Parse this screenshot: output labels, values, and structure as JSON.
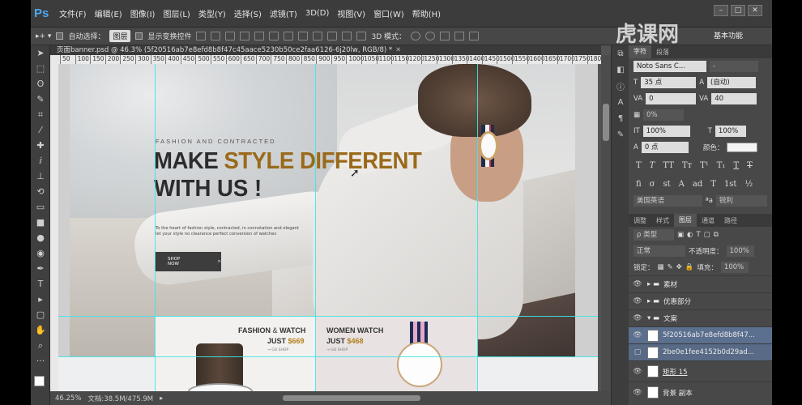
{
  "app": {
    "logo": "Ps"
  },
  "menu": [
    "文件(F)",
    "编辑(E)",
    "图像(I)",
    "图层(L)",
    "类型(Y)",
    "选择(S)",
    "滤镜(T)",
    "3D(D)",
    "视图(V)",
    "窗口(W)",
    "帮助(H)"
  ],
  "options": {
    "auto_select_label": "自动选择：",
    "auto_select_value": "图层",
    "show_transform": "显示变换控件",
    "mode_3d": "3D 模式：",
    "workspace": "基本功能"
  },
  "document": {
    "tab_title": "页面banner.psd @ 46.3% (5f20516ab7e8efd8b8f47c45aace5230b50ce2faa6126-6j20lw, RGB/8) *",
    "ruler_ticks": [
      "50",
      "100",
      "150",
      "200",
      "250",
      "300",
      "350",
      "400",
      "450",
      "500",
      "550",
      "600",
      "650",
      "700",
      "750",
      "800",
      "850",
      "900",
      "950",
      "1000",
      "1050",
      "1100",
      "1150",
      "1200",
      "1250",
      "1300",
      "1350",
      "1400",
      "1450",
      "1500",
      "1550",
      "1600",
      "1650",
      "1700",
      "1750",
      "1800"
    ]
  },
  "canvas": {
    "sub": "FASHION AND CONTRACTED",
    "head_a": "MAKE ",
    "head_b": "STYLE DIFFERENT",
    "head_c": "WITH US !",
    "para1": "To the heart of fashion style, contracted, in connotation and elegant",
    "para2": "let your style no clearance perfect conversion of watches",
    "shop": "SHOP NOW",
    "shop_arrow": ">",
    "p1_title_a": "FASHION",
    "p1_amp": "&",
    "p1_title_b": "WATCH",
    "p1_just": "JUST ",
    "p1_price": "$669",
    "p1_link": "→ GO SHOP",
    "p2_title": "WOMEN WATCH",
    "p2_just": "JUST ",
    "p2_price": "$468",
    "p2_link": "→ GO SHOP"
  },
  "status": {
    "zoom": "46.25%",
    "doc": "文档:38.5M/475.9M"
  },
  "char_panel": {
    "tabs": [
      "字符",
      "段落"
    ],
    "font": "Noto Sans C...",
    "style": "-",
    "size": "35 点",
    "leading": "(自动)",
    "kerning": "0",
    "tracking": "40",
    "vscale_percent": "0%",
    "vert_scale": "100%",
    "horiz_scale": "100%",
    "baseline": "0 点",
    "color_label": "颜色：",
    "lang": "美国英语",
    "aa_label": "ªa",
    "aa": "锐利"
  },
  "layers_panel": {
    "tabs": [
      "调整",
      "样式",
      "图层",
      "通道",
      "路径"
    ],
    "kind": "ρ 类型",
    "blend": "正常",
    "opacity_label": "不透明度：",
    "opacity": "100%",
    "lock_label": "锁定：",
    "fill_label": "填充：",
    "fill": "100%",
    "layers": [
      {
        "name": "素材"
      },
      {
        "name": "优惠部分"
      },
      {
        "name": "文案"
      },
      {
        "name": "5f20516ab7e8efd8b8f47..."
      },
      {
        "name": "2be0e1fee4152b0d29ad..."
      },
      {
        "name": "矩形 15"
      },
      {
        "name": "背景 副本"
      }
    ]
  },
  "watermark": "虎课网"
}
